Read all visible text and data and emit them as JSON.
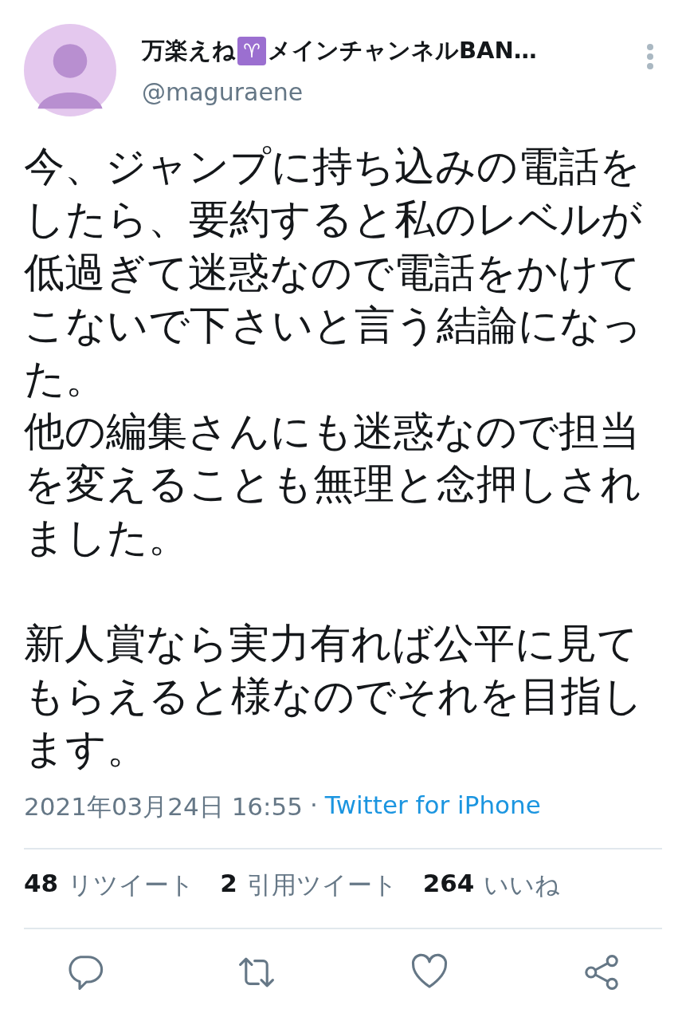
{
  "author": {
    "name_before": "万楽えね",
    "zodiac": "♈",
    "name_after": "メインチャンネルBAN…",
    "handle": "@maguraene"
  },
  "body": [
    {
      "lines": [
        "今、ジャンプに持ち込みの電話をしたら、要約すると私のレベルが低過ぎて迷惑なので電話をかけてこないで下さいと言う結論になった。",
        "他の編集さんにも迷惑なので担当を変えることも無理と念押しされました。"
      ]
    },
    {
      "lines": [
        "新人賞なら実力有れば公平に見てもらえると様なのでそれを目指します。"
      ]
    }
  ],
  "meta": {
    "timestamp": "2021年03月24日 16:55",
    "separator": "·",
    "source": "Twitter for iPhone"
  },
  "stats": [
    {
      "count": "48",
      "label": "リツイート"
    },
    {
      "count": "2",
      "label": "引用ツイート"
    },
    {
      "count": "264",
      "label": "いいね"
    }
  ],
  "actions": [
    {
      "kind": "reply"
    },
    {
      "kind": "retweet"
    },
    {
      "kind": "like"
    },
    {
      "kind": "share"
    }
  ]
}
